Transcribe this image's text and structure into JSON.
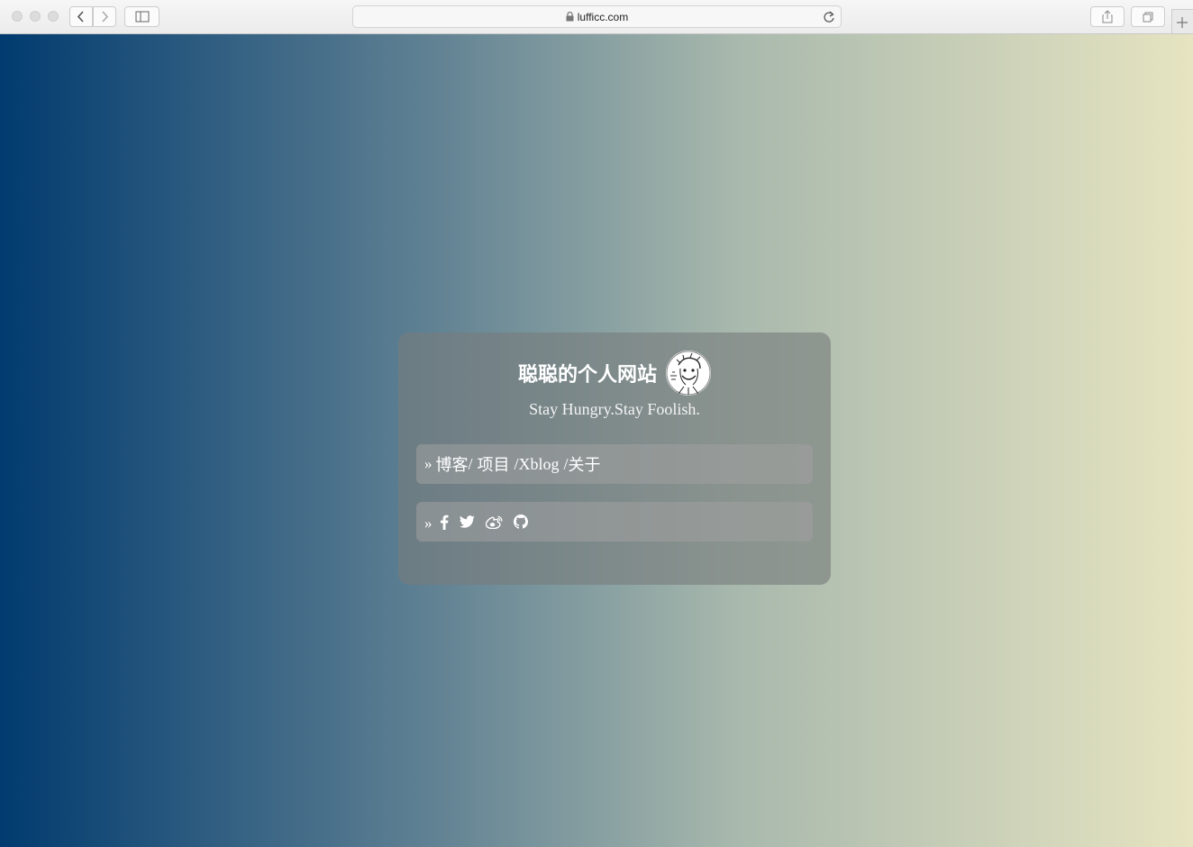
{
  "browser": {
    "url": "lufficc.com"
  },
  "site": {
    "title": "聪聪的个人网站",
    "subtitle": "Stay Hungry.Stay Foolish.",
    "nav_prefix": "»",
    "nav": [
      {
        "label": "博客"
      },
      {
        "label": "项目"
      },
      {
        "label": "Xblog"
      },
      {
        "label": "关于"
      }
    ],
    "social_prefix": "»",
    "social": [
      {
        "icon": "facebook-icon"
      },
      {
        "icon": "twitter-icon"
      },
      {
        "icon": "weibo-icon"
      },
      {
        "icon": "github-icon"
      }
    ]
  },
  "colors": {
    "gradient_start": "#013b6f",
    "gradient_end": "#e6e4c1"
  }
}
